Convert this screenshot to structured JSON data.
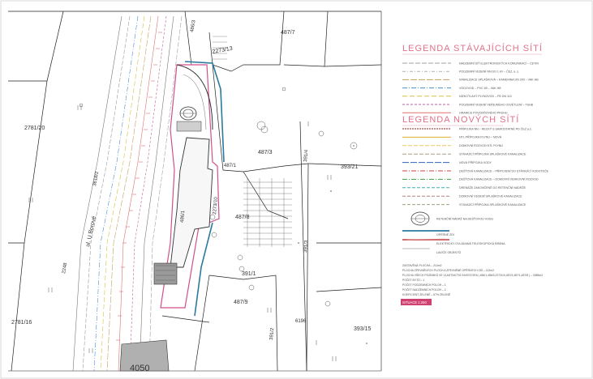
{
  "parcels": [
    {
      "id": "487/7"
    },
    {
      "id": "2273/13"
    },
    {
      "id": "487/3"
    },
    {
      "id": "2781/20"
    },
    {
      "id": "487/1"
    },
    {
      "id": "2273/10"
    },
    {
      "id": "487/8"
    },
    {
      "id": "393/21"
    },
    {
      "id": "391/4"
    },
    {
      "id": "391/3"
    },
    {
      "id": "391/1"
    },
    {
      "id": "487/9"
    },
    {
      "id": "2781/16"
    },
    {
      "id": "6196"
    },
    {
      "id": "391/2"
    },
    {
      "id": "393/15"
    },
    {
      "id": "486/3"
    },
    {
      "id": "4050"
    },
    {
      "id": "2248"
    },
    {
      "id": "3618/2"
    },
    {
      "id": "486/1"
    }
  ],
  "street": "ul. U Borové",
  "legend_existing": {
    "title": "LEGENDA STÁVAJÍCÍCH SÍTÍ",
    "items": [
      {
        "label": "NADZEMNÍ SÍŤ ELEKTRONICKÝCH KOMUNIKACÍ – CETIN",
        "color": "#a0a0a0",
        "dash": "6 2"
      },
      {
        "label": "PODZEMNÍ VEDENÍ NN DO 1 kV – ČEZ, a. s.",
        "color": "#b0b0b0",
        "dash": "4 2 1 2"
      },
      {
        "label": "KANALIZACE SPLAŠKOVÁ – KAMENINA DN 200 – VAK HB",
        "color": "#c8a060",
        "dash": "8 2"
      },
      {
        "label": "VODOVOD – PVC 80 – VAK HB",
        "color": "#4a90c8",
        "dash": "6 2 1 2"
      },
      {
        "label": "NÍZKOTLAKÝ PLYNOVOD – PE DN 110",
        "color": "#d8c040",
        "dash": "6 3"
      },
      {
        "label": "PODZEMNÍ VEDENÍ VEŘEJNÉHO OSVĚTLENÍ – TSHB",
        "color": "#c060a0",
        "dash": "3 2"
      },
      {
        "label": "HRANICE POVODŇOVÉHO PRUHU",
        "color": "#e07070",
        "dash": ""
      }
    ]
  },
  "legend_new": {
    "title": "LEGENDA NOVÝCH SÍTÍ",
    "items": [
      {
        "label": "PŘÍPOJKA NN – RECKÝ S SAMOSTATNÉ PD ČEZ a.s.",
        "color": "#8a2a2a",
        "dash": "2 1"
      },
      {
        "label": "NTL PŘÍPOJKA PLYNU – NOVÁ",
        "color": "#e0b030",
        "dash": ""
      },
      {
        "label": "DOMOVNÍ ROZVOD NTL PLYNU",
        "color": "#e8c860",
        "dash": "5 2"
      },
      {
        "label": "STÁVAJÍCÍ PŘÍPOJKA SPLAŠKOVÉ KANALIZACE",
        "color": "#a8a080",
        "dash": "5 2"
      },
      {
        "label": "NOVÁ PŘÍPOJKA VODY",
        "color": "#3060c0",
        "dash": "8 2"
      },
      {
        "label": "DEŠŤOVÁ KANALIZACE – PŘIPOJENÍ DO STÁVAJÍCÍ VODOTEČE",
        "color": "#d04040",
        "dash": "6 2 1 2"
      },
      {
        "label": "DEŠŤOVÁ KANALIZACE – DOMOVNÍ VENKOVNÍ ROZVOD",
        "color": "#40a040",
        "dash": "6 2 1 2"
      },
      {
        "label": "DRENÁŽE ZAKONČENÉ DO RETENČNÍ NÁDRŽE",
        "color": "#40b0b0",
        "dash": "4 2"
      },
      {
        "label": "DOMOVNÍ VEDENÍ SPLAŠKOVÉ KANALIZACE",
        "color": "#b08080",
        "dash": "4 2"
      },
      {
        "label": "STÁVAJÍCÍ PŘÍPOJKA SPLAŠKOVÉ KANALIZACE",
        "color": "#a0a080",
        "dash": "4 2"
      }
    ]
  },
  "symbols": [
    {
      "label": "RETENČNÍ NÁDRŽ NA DEŠŤOVOU VODU"
    },
    {
      "label": "OPĚRNÉ ZDI",
      "color": "#2a7aa0"
    },
    {
      "label": "ELEKTRICKY OVLÁDANÁ TELESKOPICKÁ BRÁNA",
      "color": "#c04040"
    },
    {
      "label": "LAVIČE OBJEKTŮ"
    }
  ],
  "notes": [
    "ZASTAVĚNÁ PLOCHA – 214m2",
    "PLOCHA ZPEVNĚNÝCH PLOCH A ZPEVNĚNÉ OPĚRNÝCH ZDÍ – 112m2",
    "PLOCHA VŠECH POZEMKŮ VE VLASTNICTVÍ INVESTORA ( 486/1,486/3,2273/10,487/3,487/1,487/8 ) – 3385m2",
    "POČET BYTŮ – 1",
    "POČET PODZEMNÍCH POLOH – 1",
    "POČET NADZEMNÍCH POLOH – 2",
    "KOEFICIENT ZELENĚ – 67% ZELENĚ"
  ],
  "stamp": "SITUACE 1:250"
}
